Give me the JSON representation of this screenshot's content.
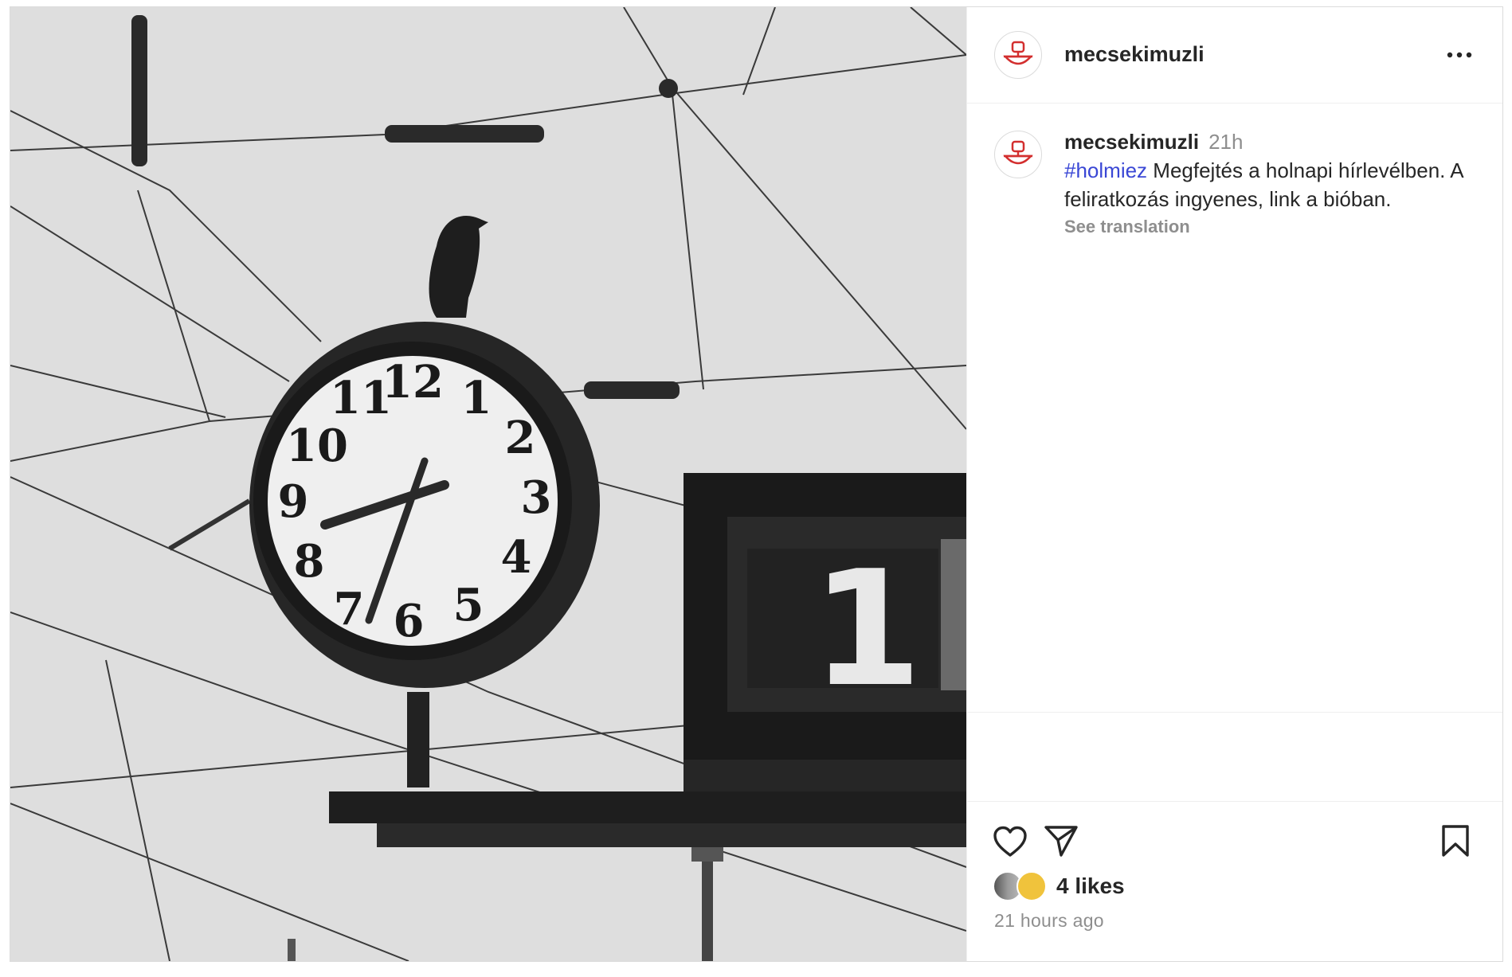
{
  "post": {
    "username": "mecsekimuzli",
    "more_icon": "more-horizontal-icon",
    "photo_panel_number": "1",
    "clock_numerals": [
      "12",
      "1",
      "2",
      "3",
      "4",
      "5",
      "6",
      "7",
      "8",
      "9",
      "10",
      "11"
    ],
    "caption": {
      "username": "mecsekimuzli",
      "time": "21h",
      "hashtag": "#holmiez",
      "text": " Megfejtés a holnapi hírlevélben. A feliratkozás ingyenes, link a bióban.",
      "see_translation": "See translation"
    },
    "actions": {
      "like_icon": "heart-icon",
      "share_icon": "send-icon",
      "save_icon": "bookmark-icon"
    },
    "likes": "4 likes",
    "posted_ago": "21 hours ago"
  }
}
